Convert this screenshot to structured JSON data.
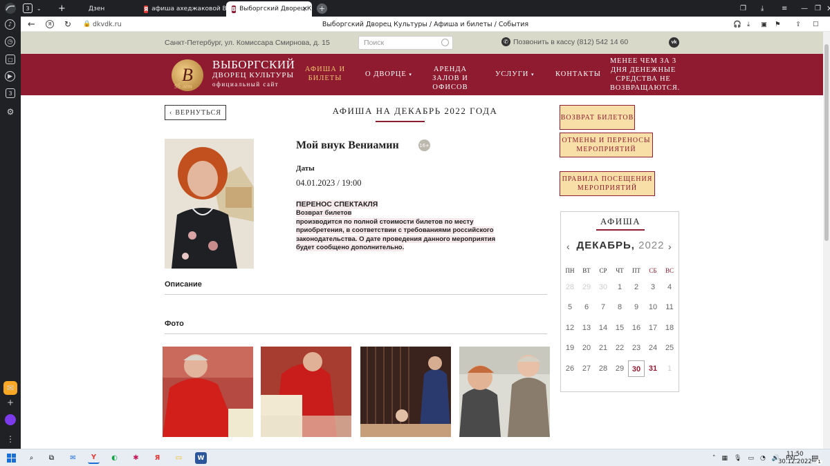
{
  "browser": {
    "tab_count": "3",
    "tabs": [
      {
        "label": "Дзен",
        "active": false
      },
      {
        "label": "афиша ахеджаковой Выбо",
        "active": false
      },
      {
        "label": "Выборгский Дворец Ку",
        "active": true
      }
    ],
    "url": "dkvdk.ru",
    "page_title": "Выборгский Дворец Культуры / Афиша и билеты / События",
    "sidebar_badge": "3"
  },
  "site": {
    "address": "Санкт-Петербург, ул. Комиссара Смирнова, д. 15",
    "search_placeholder": "Поиск",
    "phone": "Позвонить в кассу (812) 542 14 60",
    "vk": "vk",
    "logo_letter": "B",
    "logo_years": "95 лет",
    "brand_title": "ВЫБОРГСКИЙ",
    "brand_sub": "ДВОРЕЦ КУЛЬТУРЫ",
    "brand_tag": "официальный сайт",
    "nav": [
      {
        "label": "АФИША И БИЛЕТЫ",
        "active": true
      },
      {
        "label": "О ДВОРЦЕ",
        "dropdown": true
      },
      {
        "label": "АРЕНДА ЗАЛОВ И ОФИСОВ"
      },
      {
        "label": "УСЛУГИ",
        "dropdown": true
      },
      {
        "label": "КОНТАКТЫ"
      }
    ],
    "warning": "МЕНЕЕ ЧЕМ ЗА 3 ДНЯ ДЕНЕЖНЫЕ СРЕДСТВА НЕ ВОЗВРАЩАЮТСЯ."
  },
  "content": {
    "back_label": "ВЕРНУТЬСЯ",
    "heading": "АФИША НА ДЕКАБРЬ 2022 ГОДА",
    "event_title": "Мой внук Вениамин",
    "age_rating": "16+",
    "dates_label": "Даты",
    "date_value": "04.01.2023 / 19:00",
    "notice_title": "ПЕРЕНОС СПЕКТАКЛЯ",
    "notice_bold": "Возврат билетов",
    "notice_body": "производится по полной стоимости билетов по месту приобретения, в соответствии с требованиями российского законодательства.  О дате проведения данного мероприятия будет сообщено дополнительно.",
    "description_label": "Описание",
    "photo_label": "Фото"
  },
  "sidebar": {
    "buttons": [
      "ВОЗВРАТ БИЛЕТОВ",
      "ОТМЕНЫ И ПЕРЕНОСЫ МЕРОПРИЯТИЙ",
      "ПРАВИЛА ПОСЕЩЕНИЯ МЕРОПРИЯТИЙ"
    ],
    "calendar": {
      "title": "АФИША",
      "month": "ДЕКАБРЬ,",
      "year": "2022",
      "weekdays": [
        "ПН",
        "ВТ",
        "СР",
        "ЧТ",
        "ПТ",
        "СБ",
        "ВС"
      ],
      "weeks": [
        [
          "28",
          "29",
          "30",
          "1",
          "2",
          "3",
          "4"
        ],
        [
          "5",
          "6",
          "7",
          "8",
          "9",
          "10",
          "11"
        ],
        [
          "12",
          "13",
          "14",
          "15",
          "16",
          "17",
          "18"
        ],
        [
          "19",
          "20",
          "21",
          "22",
          "23",
          "24",
          "25"
        ],
        [
          "26",
          "27",
          "28",
          "29",
          "30",
          "31",
          "1"
        ]
      ],
      "dim_first_week": 3,
      "dim_last_week": 1,
      "today": "30",
      "highlight": [
        "30",
        "31"
      ]
    }
  },
  "taskbar": {
    "lang": "РУС",
    "time": "11:50",
    "date": "30.12.2022",
    "notif_count": "1"
  },
  "colors": {
    "brand_red": "#8e1b30",
    "gold": "#f0c46e",
    "button_fill": "#f8dfa7"
  }
}
